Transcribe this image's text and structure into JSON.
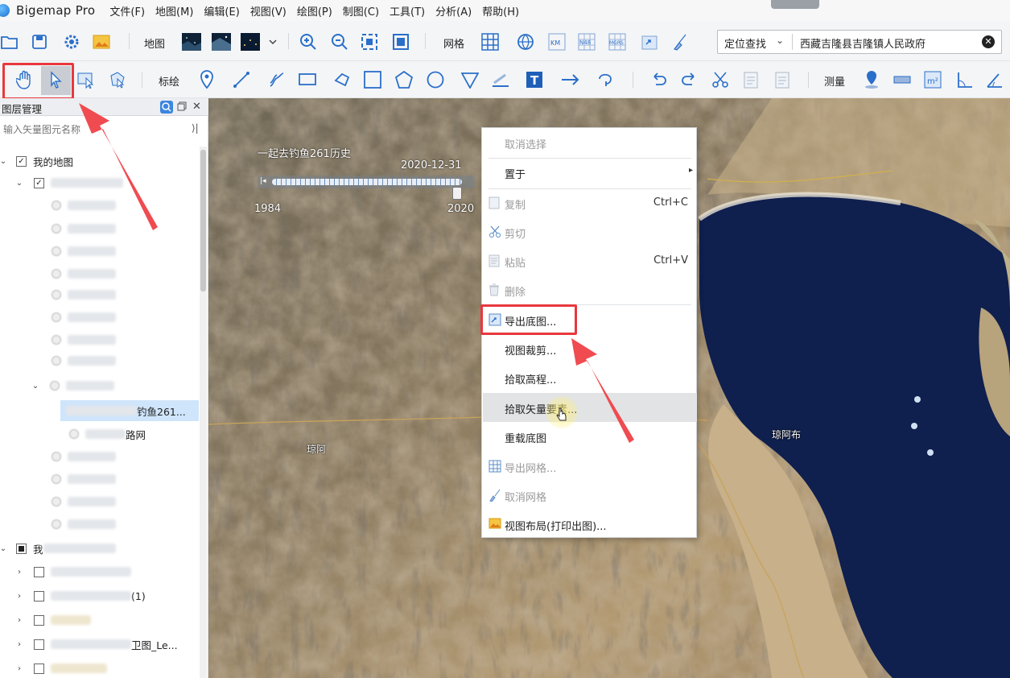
{
  "app": {
    "title": "Bigemap Pro"
  },
  "menu": [
    "文件(F)",
    "地图(M)",
    "编辑(E)",
    "视图(V)",
    "绘图(P)",
    "制图(C)",
    "工具(T)",
    "分析(A)",
    "帮助(H)"
  ],
  "toolbar1": {
    "map_label": "地图",
    "grid_label": "网格",
    "locate_select": "定位查找",
    "locate_value": "西藏吉隆县吉隆镇人民政府"
  },
  "toolbar2": {
    "annotate_label": "标绘",
    "measure_label": "测量"
  },
  "layer_panel": {
    "title": "图层管理",
    "search_placeholder": "输入矢量图元名称",
    "my_map_label": "我的地图",
    "selected_layer_suffix": "钓鱼261...",
    "road_layer_suffix": "路网",
    "second_group_prefix": "我",
    "row_suffix_1": "(1)",
    "row_suffix_2": "卫图_Le..."
  },
  "timeline": {
    "title": "一起去钓鱼261历史",
    "current_date": "2020-12-31",
    "start_year": "1984",
    "end_year": "2020",
    "position_fraction": 1.0
  },
  "map_labels": {
    "left": "琼阿",
    "right": "琼阿布"
  },
  "context_menu": {
    "cancel_select": "取消选择",
    "place": "置于",
    "copy": "复制",
    "copy_shortcut": "Ctrl+C",
    "cut": "剪切",
    "paste": "粘贴",
    "paste_shortcut": "Ctrl+V",
    "delete": "删除",
    "export_basemap": "导出底图...",
    "view_clip": "视图裁剪...",
    "pick_elevation": "拾取高程...",
    "pick_vector": "拾取矢量要素...",
    "reload_basemap": "重载底图",
    "export_grid": "导出网格...",
    "cancel_grid": "取消网格",
    "view_layout": "视图布局(打印出图)..."
  },
  "colors": {
    "highlight": "#e8383d",
    "accent": "#1e6fd9",
    "lake": "#0f1f4e"
  }
}
